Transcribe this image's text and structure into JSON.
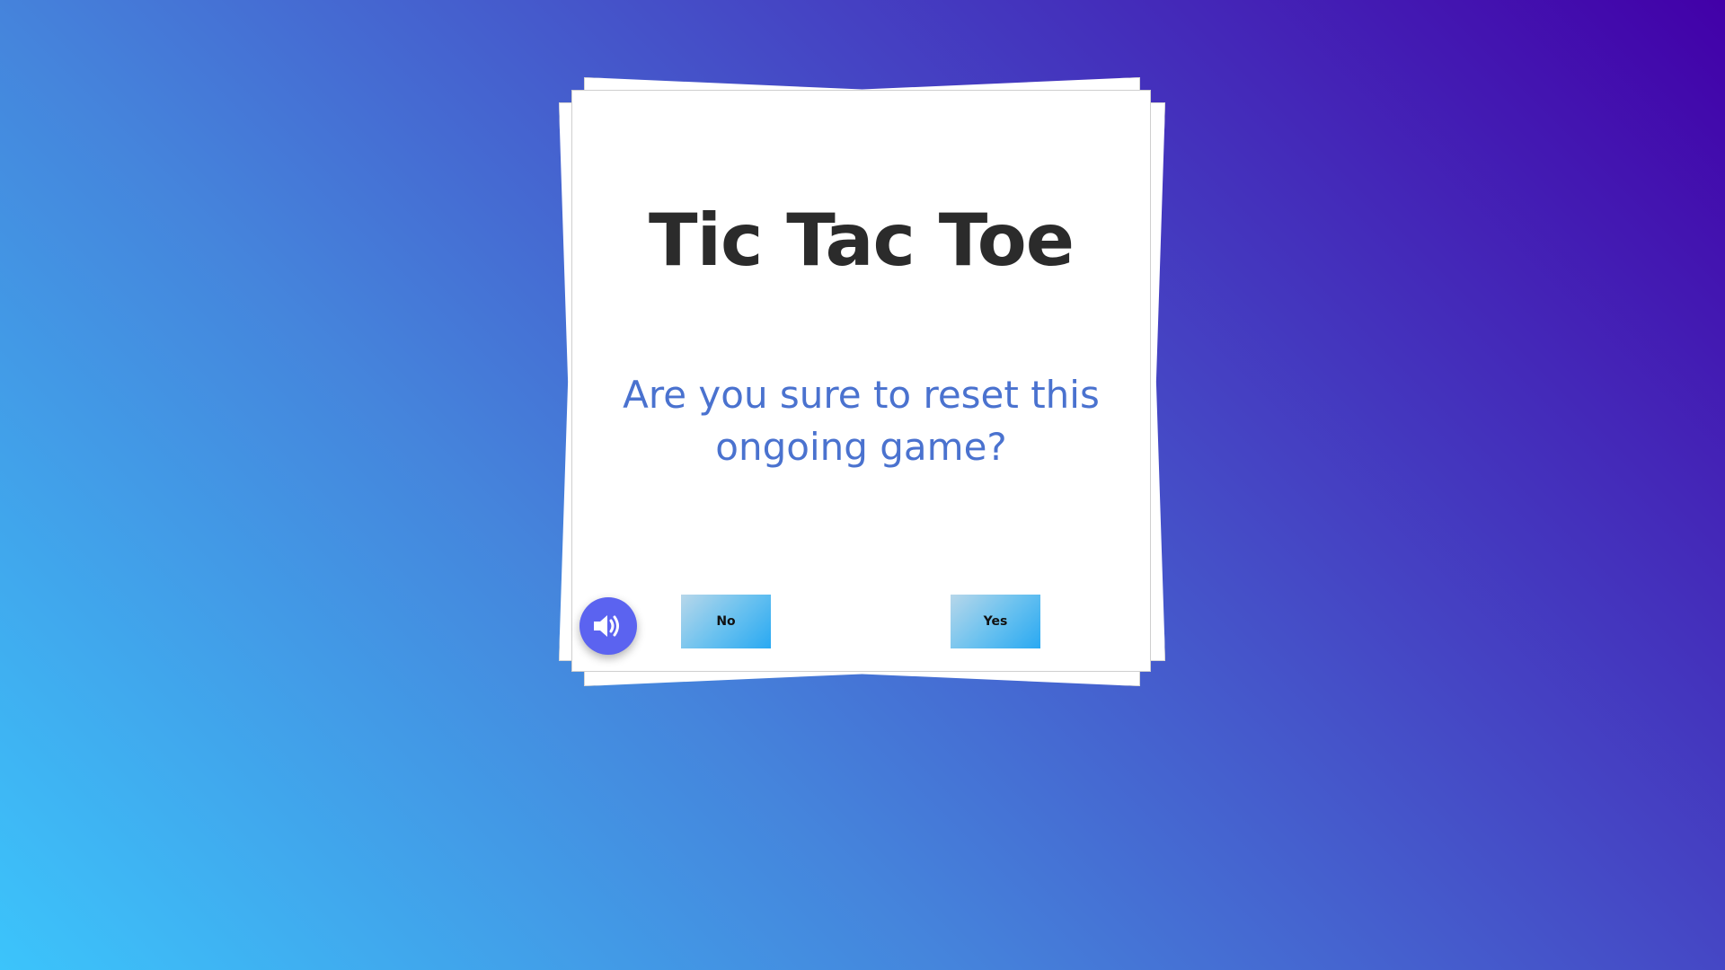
{
  "game": {
    "title": "Tic Tac Toe",
    "dialog": {
      "question": "Are you sure to reset this ongoing game?",
      "no_label": "No",
      "yes_label": "Yes"
    }
  },
  "sound_toggle": {
    "icon": "volume-up-icon",
    "state": "on"
  },
  "colors": {
    "title": "#2b2b2b",
    "question": "#4a72cf",
    "sound_button": "#5b63f0",
    "background_start": "#3cc4fb",
    "background_end": "#4200a8"
  }
}
